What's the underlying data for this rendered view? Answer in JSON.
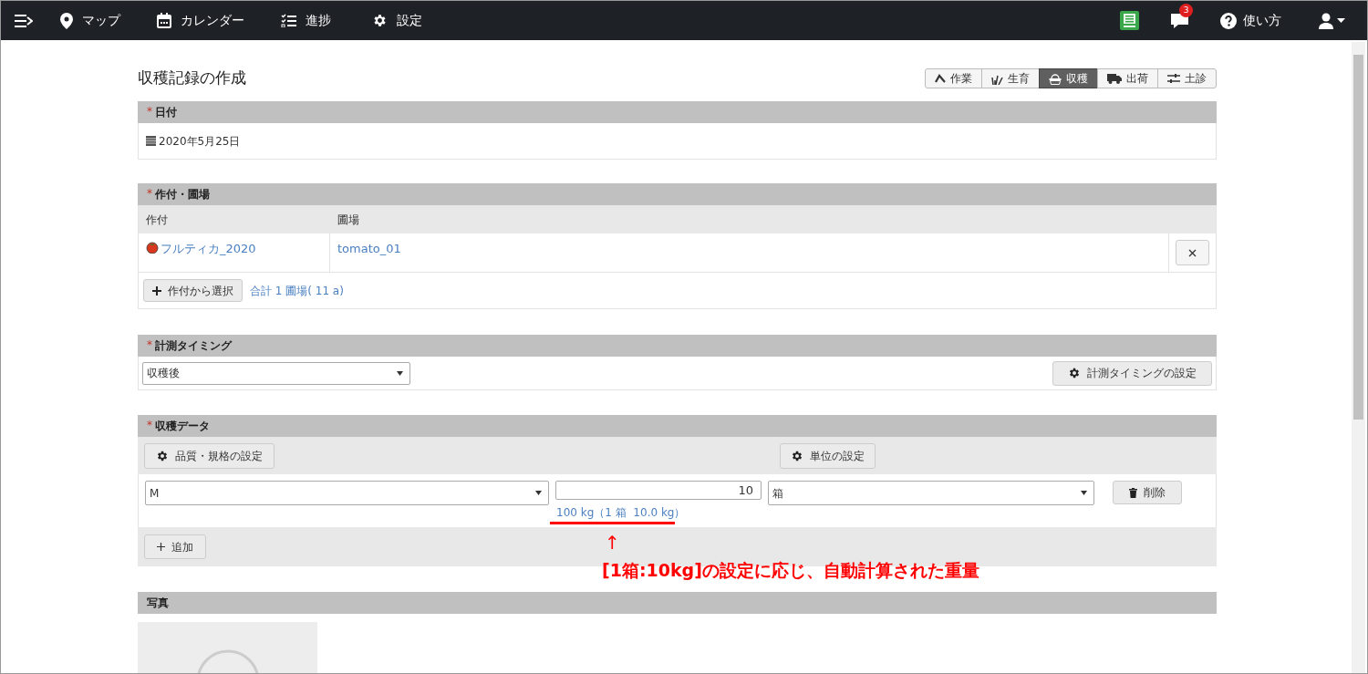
{
  "nav": {
    "items": [
      {
        "kind": "map",
        "label": "マップ"
      },
      {
        "kind": "calendar",
        "label": "カレンダー"
      },
      {
        "kind": "progress",
        "label": "進捗"
      },
      {
        "kind": "settings",
        "label": "設定"
      }
    ],
    "notification_count": "3",
    "help": "使い方"
  },
  "page": {
    "title": "収穫記録の作成",
    "record_tabs": [
      {
        "kind": "work",
        "label": "作業",
        "selected": false
      },
      {
        "kind": "growth",
        "label": "生育",
        "selected": false
      },
      {
        "kind": "harvest",
        "label": "収穫",
        "selected": true
      },
      {
        "kind": "shipping",
        "label": "出荷",
        "selected": false
      },
      {
        "kind": "soil",
        "label": "土診",
        "selected": false
      }
    ]
  },
  "date_section": {
    "title": "日付",
    "required_mark": "*",
    "value": "2020年5月25日"
  },
  "crop_section": {
    "title": "作付・圃場",
    "required_mark": "*",
    "columns": [
      "作付",
      "圃場"
    ],
    "rows": [
      {
        "crop": "フルティカ_2020",
        "field": "tomato_01"
      }
    ],
    "select_button": "作付から選択",
    "total": "合計 1 圃場( 11 a)"
  },
  "timing_section": {
    "title": "計測タイミング",
    "required_mark": "*",
    "select_value": "収穫後",
    "settings_button": "計測タイミングの設定"
  },
  "harvest_section": {
    "title": "収穫データ",
    "required_mark": "*",
    "quality_button": "品質・規格の設定",
    "unit_button": "単位の設定",
    "rows": [
      {
        "grade": "M",
        "amount": "10",
        "unit": "箱",
        "calc": "100 kg（1 箱  10.0 kg）",
        "delete_button": "削除"
      }
    ],
    "add_button": "追加"
  },
  "annotation": {
    "arrow": "↑",
    "text": "[1箱:10kg]の設定に応じ、自動計算された重量"
  },
  "photo_section": {
    "title": "写真"
  }
}
